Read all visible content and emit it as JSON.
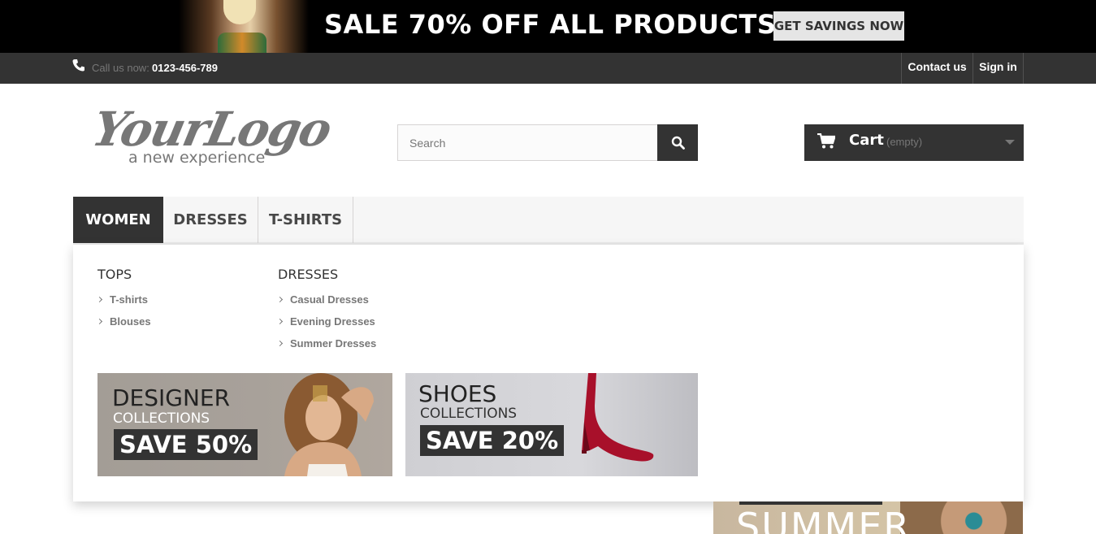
{
  "promo": {
    "text": "SALE 70% OFF ALL PRODUCTS",
    "button": "GET SAVINGS NOW"
  },
  "topbar": {
    "call_label": "Call us now:",
    "phone": "0123-456-789",
    "contact": "Contact us",
    "signin": "Sign in"
  },
  "logo": {
    "script": "YourLogo",
    "tagline": "a new experience"
  },
  "search": {
    "placeholder": "Search"
  },
  "cart": {
    "label": "Cart",
    "status": "(empty)"
  },
  "menu": {
    "items": [
      "WOMEN",
      "DRESSES",
      "T-SHIRTS"
    ]
  },
  "dropdown": {
    "columns": [
      {
        "title": "TOPS",
        "links": [
          "T-shirts",
          "Blouses"
        ]
      },
      {
        "title": "DRESSES",
        "links": [
          "Casual Dresses",
          "Evening Dresses",
          "Summer Dresses"
        ]
      }
    ],
    "banners": [
      {
        "headline": "DESIGNER",
        "sub": "COLLECTIONS",
        "offer": "SAVE 50%"
      },
      {
        "headline": "SHOES",
        "sub": "COLLECTIONS",
        "offer": "SAVE 20%"
      }
    ]
  },
  "summer_banner": {
    "text": "SUMMER"
  },
  "colors": {
    "dark": "#333333",
    "muted": "#777777",
    "menu_bg": "#f6f6f6"
  }
}
